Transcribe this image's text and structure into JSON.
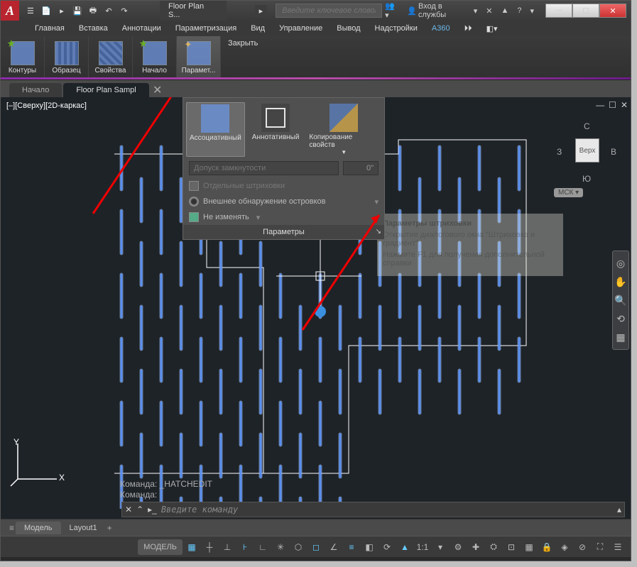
{
  "app_letter": "A",
  "qat": [
    "☰",
    "📄",
    "▸",
    "🖶",
    "↶",
    "↷"
  ],
  "title_tab": "Floor Plan S...",
  "search_placeholder": "Введите ключевое слово/фразу",
  "title_right": {
    "login": "Вход в службы",
    "help": "?"
  },
  "menu": [
    "Главная",
    "Вставка",
    "Аннотации",
    "Параметризация",
    "Вид",
    "Управление",
    "Вывод",
    "Надстройки",
    "A360"
  ],
  "ribbon": [
    {
      "label": "Контуры"
    },
    {
      "label": "Образец"
    },
    {
      "label": "Свойства"
    },
    {
      "label": "Начало"
    },
    {
      "label": "Парамет..."
    }
  ],
  "ribbon_close": "Закрыть",
  "doctabs": [
    {
      "label": "Начало",
      "active": false
    },
    {
      "label": "Floor Plan Sampl",
      "active": true
    }
  ],
  "view_label": "[–][Сверху][2D-каркас]",
  "flyout": {
    "items": [
      {
        "label": "Ассоциативный"
      },
      {
        "label": "Аннотативный"
      },
      {
        "label": "Копирование свойств"
      }
    ],
    "gap_label": "Допуск замкнутости",
    "gap_value": "0\"",
    "opt1": "Отдельные штриховки",
    "opt2": "Внешнее обнаружение островков",
    "opt3": "Не изменять",
    "footer": "Параметры"
  },
  "tooltip": {
    "title": "Параметры штриховки",
    "body": "Открытие диалогового окна \"Штриховка и градиент\"",
    "hint": "Нажмите F1 для получения дополнительной справки"
  },
  "viewcube": {
    "face": "Верх",
    "n": "С",
    "s": "Ю",
    "e": "В",
    "w": "З",
    "wcs": "МСК"
  },
  "cmd_hist": [
    "Команда: _HATCHEDIT",
    "Команда:"
  ],
  "cmd_placeholder": "Введите команду",
  "layouttabs": [
    {
      "label": "Модель",
      "active": true
    },
    {
      "label": "Layout1",
      "active": false
    }
  ],
  "status_model": "МОДЕЛЬ",
  "status_scale": "1:1",
  "ucs": {
    "x": "X",
    "y": "Y"
  }
}
